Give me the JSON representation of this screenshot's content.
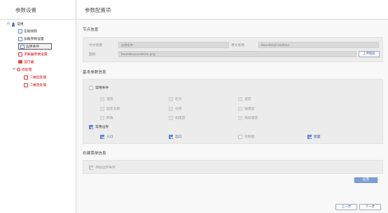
{
  "left": {
    "title": "参数设置",
    "tree": [
      {
        "label": "常用",
        "toggle": "⊟",
        "icon": "person"
      },
      {
        "label": "压缩规则",
        "icon": "doc"
      },
      {
        "label": "加载参数设置",
        "icon": "doc"
      },
      {
        "label": "边界条件",
        "icon": "doc",
        "selected": true
      },
      {
        "label": "求解器参数设置",
        "icon": "doc-red"
      },
      {
        "label": "运行器",
        "icon": "folder-red"
      },
      {
        "label": "后处理",
        "toggle": "⊟",
        "icon": "search"
      },
      {
        "label": "二维后处理",
        "icon": "doc-red"
      },
      {
        "label": "二维后处理",
        "icon": "doc-red"
      }
    ]
  },
  "right": {
    "title": "参数配置项",
    "node_info": {
      "section_title": "节点信息",
      "cn_name_label": "中文名称",
      "cn_name_value": "边界条件",
      "en_name_label": "英文名称",
      "en_name_value": "BoundaryCondition",
      "icon_label": "图标",
      "icon_value": "boundarycondition.png",
      "upload_button": "上传图标"
    },
    "basic_params": {
      "section_title": "基本参数信息",
      "group1": {
        "label": "常用条件",
        "checked": false,
        "items": [
          {
            "label": "速度",
            "checked": false
          },
          {
            "label": "压力",
            "checked": false
          },
          {
            "label": "温度",
            "checked": false
          },
          {
            "label": "固定支撑",
            "checked": false
          },
          {
            "label": "位移",
            "checked": false
          },
          {
            "label": "角速度",
            "checked": false
          },
          {
            "label": "转角",
            "checked": false
          },
          {
            "label": "加速度",
            "checked": false
          },
          {
            "label": "角加速度",
            "checked": false
          }
        ]
      },
      "group2": {
        "label": "常用边界",
        "checked": true,
        "items": [
          {
            "label": "入口",
            "checked": true
          },
          {
            "label": "出口",
            "checked": true
          },
          {
            "label": "对称面",
            "checked": false
          },
          {
            "label": "壁面",
            "checked": true
          }
        ]
      }
    },
    "context_menu": {
      "section_title": "右键菜单信息",
      "item_label": "添加边界条件",
      "item_checked": true
    },
    "apply_button": "应用",
    "prev_button": "上一步",
    "next_button": "下一步"
  },
  "colors": {
    "accent": "#6f8fd0",
    "red": "#e00000",
    "panel_bg": "#ececec"
  }
}
